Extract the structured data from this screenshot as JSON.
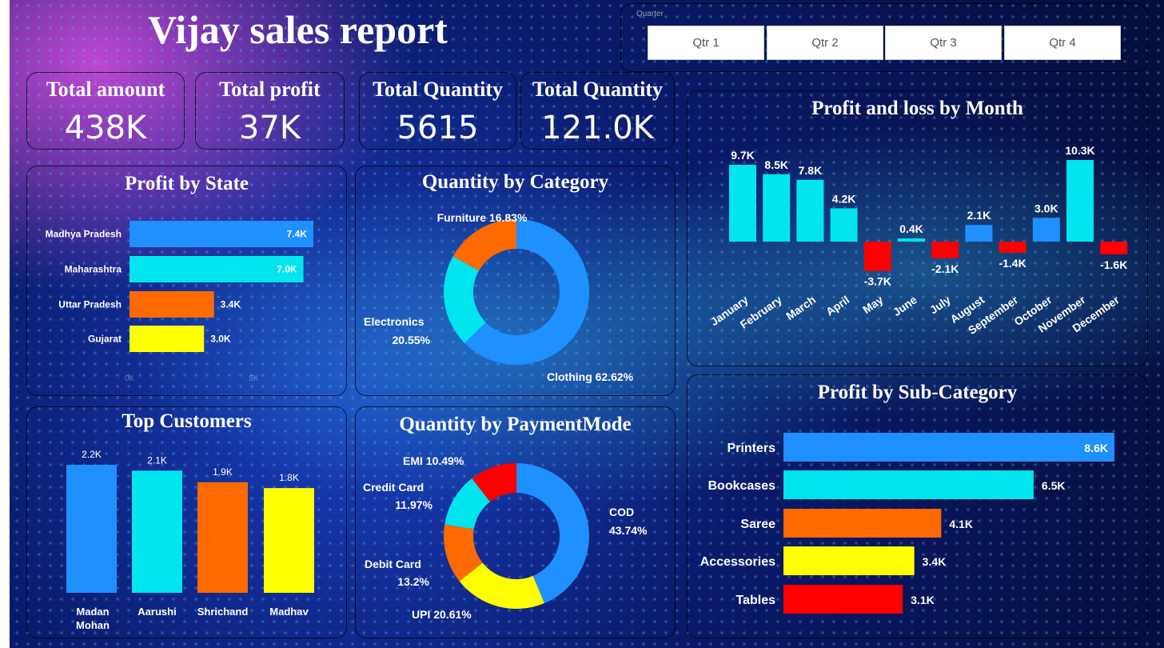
{
  "report_title": "Vijay sales report",
  "slicer": {
    "header": "Quarter",
    "options": [
      "Qtr 1",
      "Qtr 2",
      "Qtr 3",
      "Qtr 4"
    ]
  },
  "kpis": [
    {
      "label": "Total amount",
      "value": "438K"
    },
    {
      "label": "Total profit",
      "value": "37K"
    },
    {
      "label": "Total Quantity",
      "value": "5615"
    },
    {
      "label": "Total Quantity",
      "value": "121.0K"
    }
  ],
  "colors": {
    "blue": "#1e90ff",
    "cyan": "#00e5ee",
    "orange": "#ff6a00",
    "yellow": "#ffff00",
    "red": "#ff0000"
  },
  "chart_data": [
    {
      "type": "bar",
      "orientation": "horizontal",
      "title": "Profit by State",
      "categories": [
        "Madhya Pradesh",
        "Maharashtra",
        "Uttar Pradesh",
        "Gujarat"
      ],
      "values": [
        7.4,
        7.0,
        3.4,
        3.0
      ],
      "data_labels": [
        "7.4K",
        "7.0K",
        "3.4K",
        "3.0K"
      ],
      "axis_ticks": [
        "0K",
        "5K"
      ],
      "colors": [
        "#1e90ff",
        "#00e5ee",
        "#ff6a00",
        "#ffff00"
      ]
    },
    {
      "type": "pie",
      "subtype": "donut",
      "title": "Quantity by Category",
      "categories": [
        "Clothing",
        "Electronics",
        "Furniture"
      ],
      "values": [
        62.62,
        20.55,
        16.83
      ],
      "labels": [
        "Clothing 62.62%",
        "Electronics",
        "20.55%",
        "Furniture 16.83%"
      ],
      "colors": [
        "#1e90ff",
        "#00e5ee",
        "#ff6a00"
      ]
    },
    {
      "type": "bar",
      "title": "Profit and loss by Month",
      "categories": [
        "January",
        "February",
        "March",
        "April",
        "May",
        "June",
        "July",
        "August",
        "September",
        "October",
        "November",
        "December"
      ],
      "values": [
        9.7,
        8.5,
        7.8,
        4.2,
        -3.7,
        0.4,
        -2.1,
        2.1,
        -1.4,
        3.0,
        10.3,
        -1.6
      ],
      "data_labels": [
        "9.7K",
        "8.5K",
        "7.8K",
        "4.2K",
        "-3.7K",
        "0.4K",
        "-2.1K",
        "2.1K",
        "-1.4K",
        "3.0K",
        "10.3K",
        "-1.6K"
      ],
      "colors": [
        "#00e5ee",
        "#00e5ee",
        "#00e5ee",
        "#00e5ee",
        "#ff0000",
        "#00e5ee",
        "#ff0000",
        "#1e90ff",
        "#ff0000",
        "#1e90ff",
        "#00e5ee",
        "#ff0000"
      ]
    },
    {
      "type": "bar",
      "title": "Top Customers",
      "categories": [
        "Madan Mohan",
        "Aarushi",
        "Shrichand",
        "Madhav"
      ],
      "values": [
        2.2,
        2.1,
        1.9,
        1.8
      ],
      "data_labels": [
        "2.2K",
        "2.1K",
        "1.9K",
        "1.8K"
      ],
      "colors": [
        "#1e90ff",
        "#00e5ee",
        "#ff6a00",
        "#ffff00"
      ]
    },
    {
      "type": "pie",
      "subtype": "donut",
      "title": "Quantity by PaymentMode",
      "categories": [
        "COD",
        "UPI",
        "Debit Card",
        "Credit Card",
        "EMI"
      ],
      "values": [
        43.74,
        20.61,
        13.2,
        11.97,
        10.49
      ],
      "labels": [
        "COD",
        "43.74%",
        "UPI 20.61%",
        "Debit Card",
        "13.2%",
        "Credit Card",
        "11.97%",
        "EMI 10.49%"
      ],
      "colors": [
        "#1e90ff",
        "#ffff00",
        "#ff6a00",
        "#00e5ee",
        "#ff0000"
      ]
    },
    {
      "type": "bar",
      "orientation": "horizontal",
      "title": "Profit by Sub-Category",
      "categories": [
        "Printers",
        "Bookcases",
        "Saree",
        "Accessories",
        "Tables"
      ],
      "values": [
        8.6,
        6.5,
        4.1,
        3.4,
        3.1
      ],
      "data_labels": [
        "8.6K",
        "6.5K",
        "4.1K",
        "3.4K",
        "3.1K"
      ],
      "colors": [
        "#1e90ff",
        "#00e5ee",
        "#ff6a00",
        "#ffff00",
        "#ff0000"
      ]
    }
  ]
}
